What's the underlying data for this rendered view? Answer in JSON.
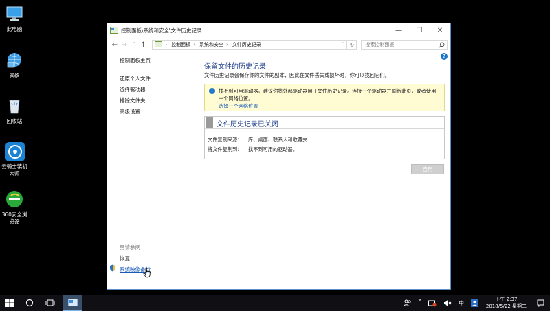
{
  "desktop": {
    "icons": [
      {
        "label": "此电脑"
      },
      {
        "label": "网络"
      },
      {
        "label": "回收站"
      },
      {
        "label": "云骑士装机大师"
      },
      {
        "label": "360安全浏览器"
      }
    ]
  },
  "window": {
    "title": "控制面板\\系统和安全\\文件历史记录",
    "breadcrumb": [
      "控制面板",
      "系统和安全",
      "文件历史记录"
    ],
    "search_placeholder": "搜索控制面板"
  },
  "sidebar": {
    "home": "控制面板主页",
    "items": [
      "还原个人文件",
      "选择驱动器",
      "排除文件夹",
      "高级设置"
    ],
    "see_also_heading": "另请参阅",
    "see_also": [
      "恢复",
      "系统映像备份"
    ]
  },
  "main": {
    "title": "保留文件的历史记录",
    "description": "文件历史记录会保存你的文件的副本，因此在文件丢失或损坏时，你可以找回它们。",
    "warning_text": "找不到可用驱动器。建议你将外部驱动器用于文件历史记录。连接一个驱动器并刷新此页，或者使用一个网络位置。",
    "warning_link": "选择一个网络位置",
    "status_title": "文件历史记录已关闭",
    "copy_from_label": "文件复制来源：",
    "copy_from_value": "库、桌面、联系人和收藏夹",
    "copy_to_label": "将文件复制到：",
    "copy_to_value": "找不到可用的驱动器。",
    "enable_button": "启用"
  },
  "taskbar": {
    "ime": "中",
    "time": "下午 2:37",
    "date": "2018/5/22 星期二"
  },
  "colors": {
    "accent": "#1a73c9",
    "title_blue": "#1e3f8a",
    "warning_bg": "#fffbd3"
  }
}
